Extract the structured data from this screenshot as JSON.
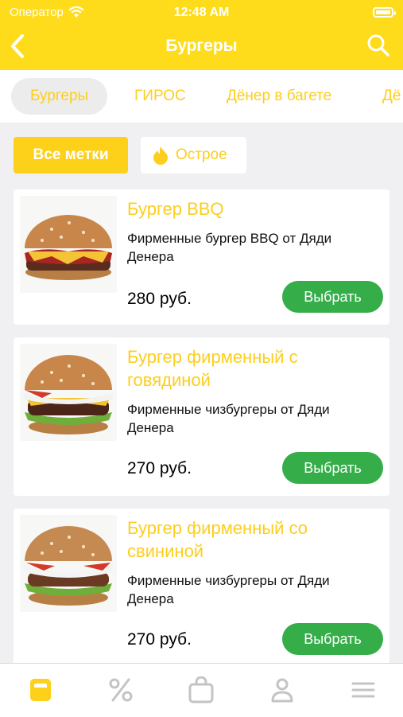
{
  "status": {
    "carrier": "Оператор",
    "time": "12:48 AM"
  },
  "header": {
    "title": "Бургеры"
  },
  "categories": [
    "Бургеры",
    "ГИРОС",
    "Дёнер в багете",
    "Дё"
  ],
  "filters": {
    "all": "Все метки",
    "spicy": "Острое"
  },
  "products": [
    {
      "title": "Бургер BBQ",
      "description": "Фирменные бургер BBQ от Дяди Денера",
      "price": "280 руб.",
      "button": "Выбрать"
    },
    {
      "title": "Бургер фирменный с говядиной",
      "description": "Фирменные чизбургеры от Дяди Денера",
      "price": "270 руб.",
      "button": "Выбрать"
    },
    {
      "title": "Бургер фирменный со свининой",
      "description": "Фирменные чизбургеры от Дяди Денера",
      "price": "270 руб.",
      "button": "Выбрать"
    }
  ],
  "tabbar": [
    "menu-icon",
    "percent-icon",
    "bag-icon",
    "profile-icon",
    "hamburger-menu-icon"
  ],
  "colors": {
    "accent": "#fedc1c",
    "button": "#35ae4a",
    "tab_active": "#fdce1d",
    "tab_inactive": "#c4c4c4"
  }
}
